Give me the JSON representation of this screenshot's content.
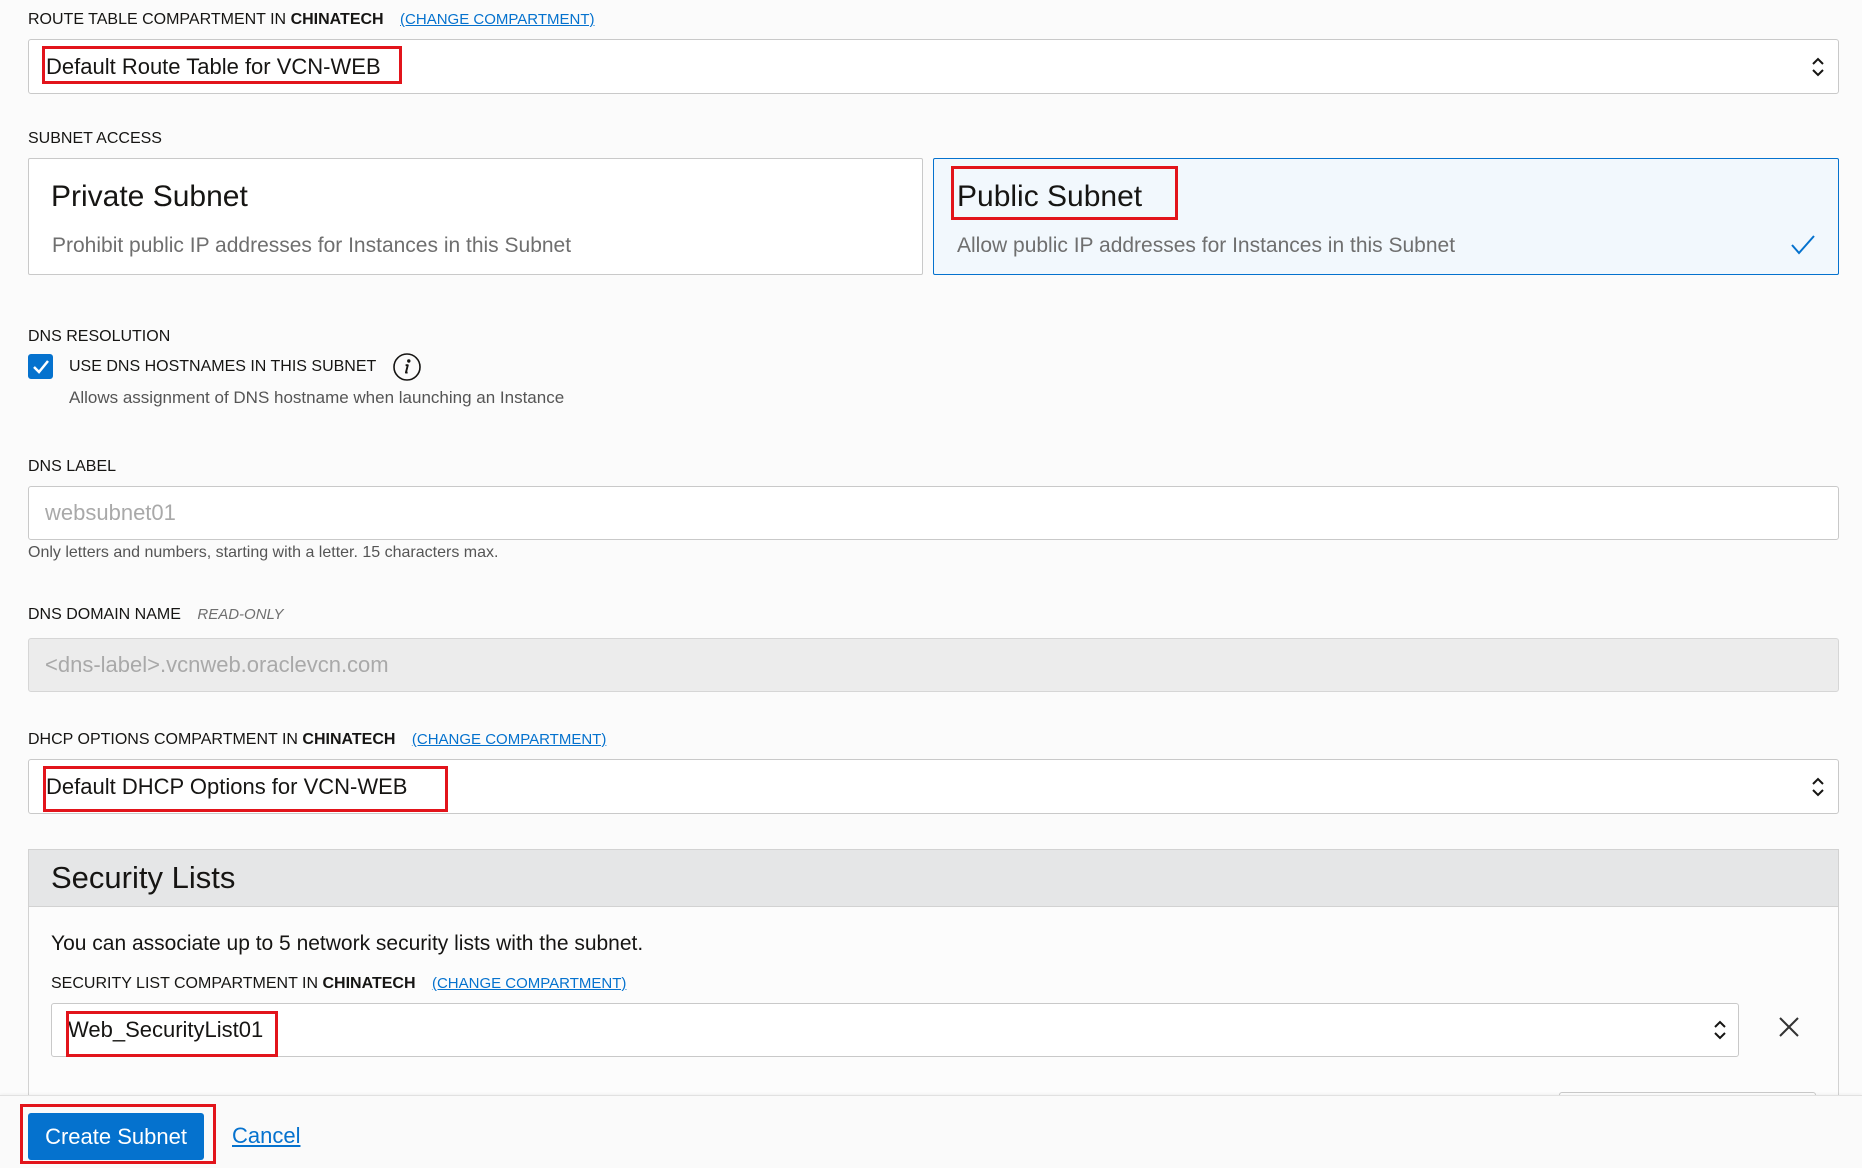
{
  "colors": {
    "accent": "#0572ce",
    "annotation": "#e2141b"
  },
  "route_table": {
    "label_prefix": "ROUTE TABLE COMPARTMENT IN",
    "compartment": "CHINATECH",
    "change_link": "(CHANGE COMPARTMENT)",
    "selected": "Default Route Table for VCN-WEB"
  },
  "subnet_access": {
    "label": "SUBNET ACCESS",
    "options": [
      {
        "title": "Private Subnet",
        "description": "Prohibit public IP addresses for Instances in this Subnet",
        "selected": false
      },
      {
        "title": "Public Subnet",
        "description": "Allow public IP addresses for Instances in this Subnet",
        "selected": true
      }
    ]
  },
  "dns_resolution": {
    "label": "DNS RESOLUTION",
    "checkbox_label": "USE DNS HOSTNAMES IN THIS SUBNET",
    "checked": true,
    "help": "Allows assignment of DNS hostname when launching an Instance"
  },
  "dns_label": {
    "label": "DNS LABEL",
    "placeholder": "websubnet01",
    "help": "Only letters and numbers, starting with a letter. 15 characters max."
  },
  "dns_domain": {
    "label": "DNS DOMAIN NAME",
    "badge": "READ-ONLY",
    "placeholder": "<dns-label>.vcnweb.oraclevcn.com"
  },
  "dhcp": {
    "label_prefix": "DHCP OPTIONS COMPARTMENT IN",
    "compartment": "CHINATECH",
    "change_link": "(CHANGE COMPARTMENT)",
    "selected": "Default DHCP Options for VCN-WEB"
  },
  "security_lists": {
    "title": "Security Lists",
    "description": "You can associate up to 5 network security lists with the subnet.",
    "label_prefix": "SECURITY LIST COMPARTMENT IN",
    "compartment": "CHINATECH",
    "change_link": "(CHANGE COMPARTMENT)",
    "selected": "Web_SecurityList01"
  },
  "footer": {
    "create_label": "Create Subnet",
    "cancel_label": "Cancel"
  },
  "icons": {
    "select": "chevron-up-down-icon",
    "selected_card": "checkmark-icon",
    "info": "info-icon",
    "remove": "close-icon"
  }
}
